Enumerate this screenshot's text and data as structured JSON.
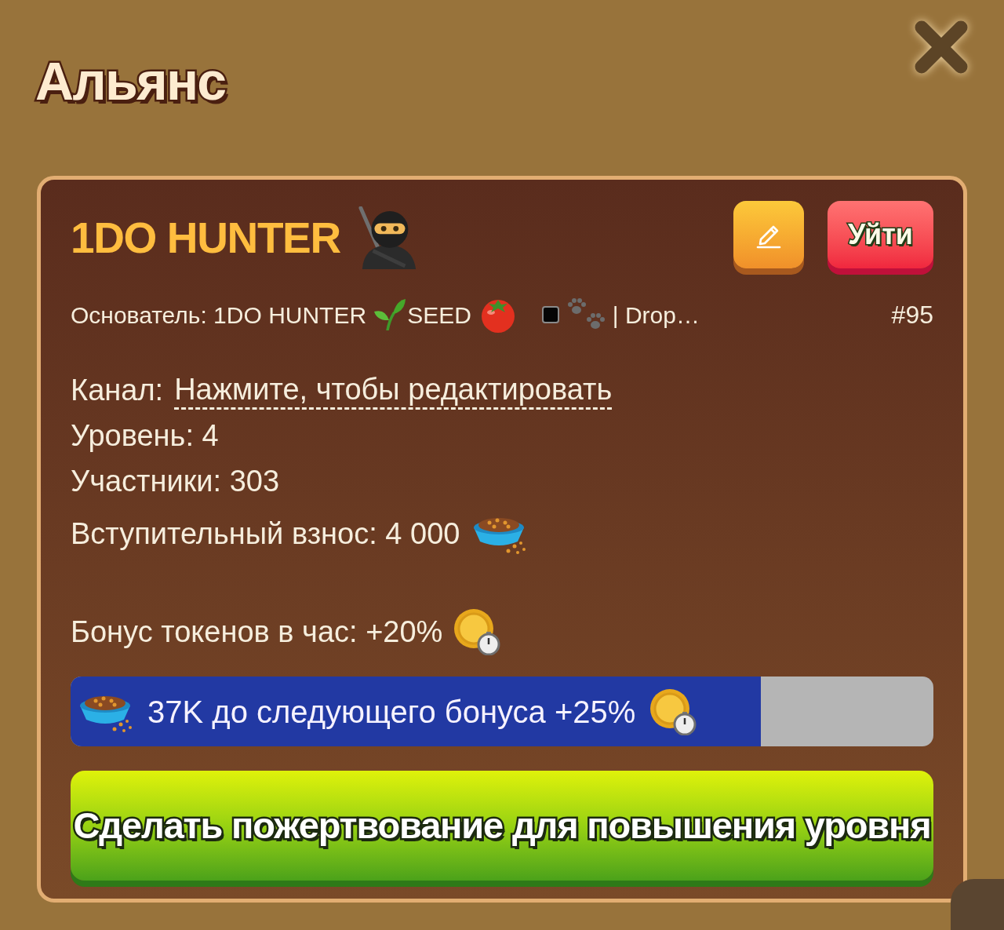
{
  "header": {
    "title": "Альянс"
  },
  "alliance": {
    "name": "1DO HUNTER",
    "actions": [
      {
        "kind": "edit"
      },
      {
        "kind": "leave",
        "label": "Уйти"
      }
    ],
    "founder": {
      "label": "Основатель:",
      "name": "1DO HUNTER",
      "tag": "SEED",
      "suffix": "| Drop…"
    },
    "rank": "#95",
    "channel": {
      "label": "Канал:",
      "link": "Нажмите, чтобы редактировать"
    },
    "stats": [
      {
        "kind": "count",
        "label": "Уровень:",
        "value": "4"
      },
      {
        "kind": "count",
        "label": "Участники:",
        "value": "303"
      },
      {
        "kind": "price",
        "label": "Вступительный взнос:",
        "value": "4 000"
      }
    ],
    "bonus": {
      "label": "Бонус токенов в час:",
      "value": "+20%"
    },
    "progress": {
      "level": 0.8,
      "text": "37K до следующего бонуса +25%"
    },
    "donate_button": {
      "label": "Сделать пожертвование для повышения уровня"
    }
  }
}
